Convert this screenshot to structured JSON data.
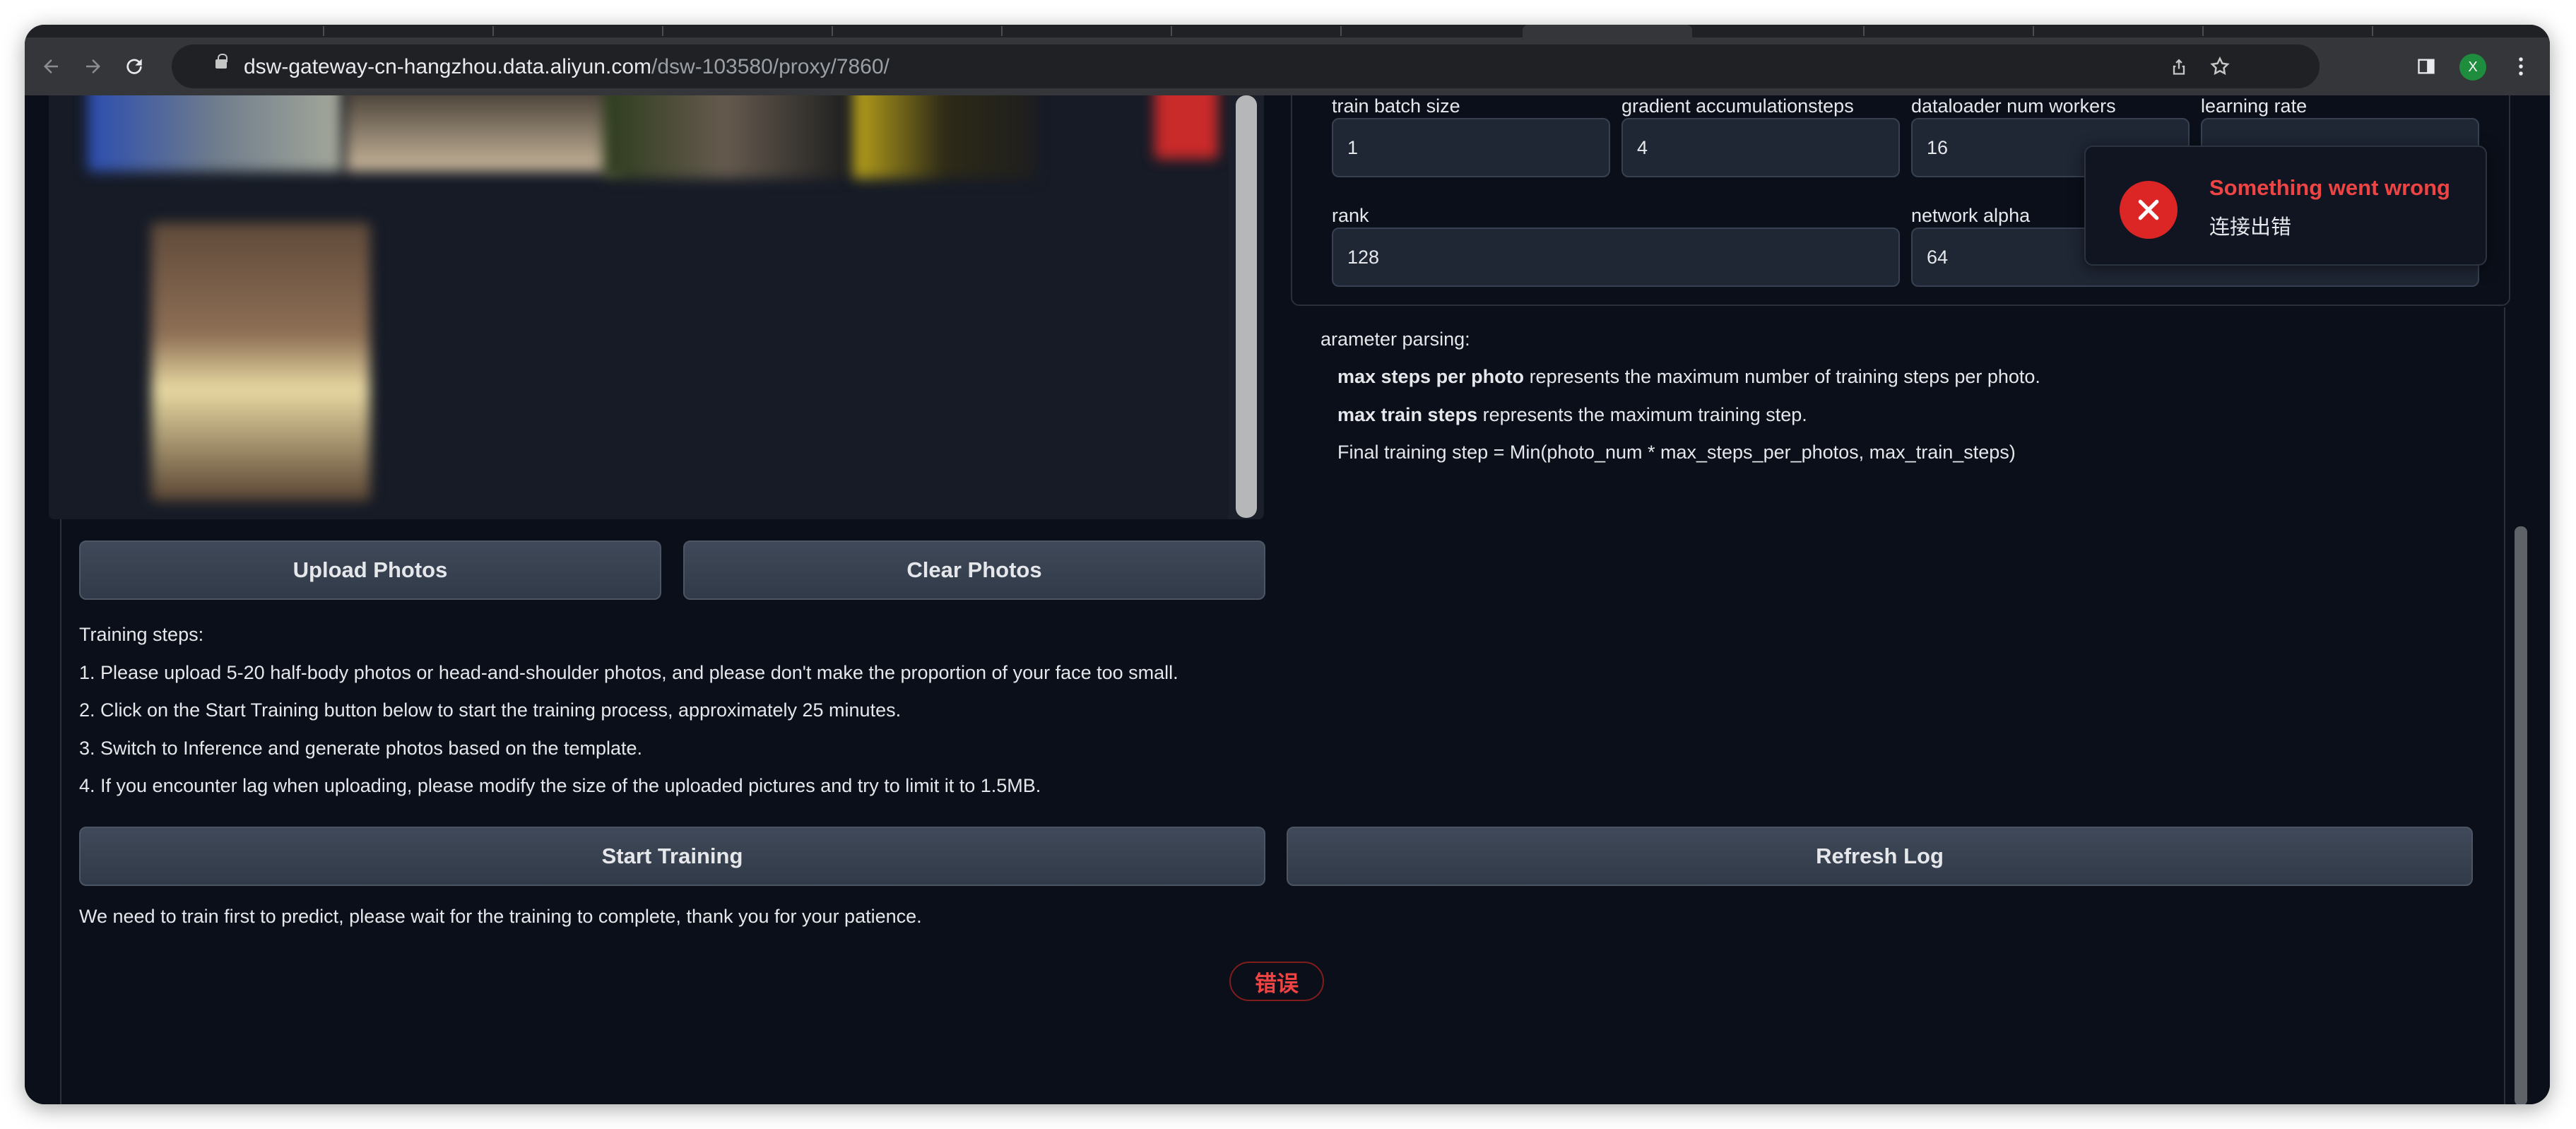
{
  "browser": {
    "url_host": "dsw-gateway-cn-hangzhou.data.aliyun.com",
    "url_path": "/dsw-103580/proxy/7860/",
    "profile_initial": "X"
  },
  "params": {
    "train_batch_size_label": "train batch size",
    "train_batch_size_value": "1",
    "grad_accum_label": "gradient accumulationsteps",
    "grad_accum_value": "4",
    "dataloader_label": "dataloader num workers",
    "dataloader_value": "16",
    "learning_rate_label": "learning rate",
    "rank_label": "rank",
    "rank_value": "128",
    "network_alpha_label": "network alpha",
    "network_alpha_value": "64"
  },
  "parsing": {
    "heading": "arameter parsing:",
    "line1_bold": "max steps per photo",
    "line1_rest": " represents the maximum number of training steps per photo.",
    "line2_bold": "max train steps",
    "line2_rest": " represents the maximum training step.",
    "line3": "Final training step = Min(photo_num * max_steps_per_photos, max_train_steps)"
  },
  "buttons": {
    "upload": "Upload Photos",
    "clear": "Clear Photos",
    "start": "Start Training",
    "refresh": "Refresh Log"
  },
  "steps": {
    "heading": "Training steps:",
    "s1": "1. Please upload 5-20 half-body photos or head-and-shoulder photos, and please don't make the proportion of your face too small.",
    "s2": "2. Click on the Start Training button below to start the training process, approximately 25 minutes.",
    "s3": "3. Switch to Inference and generate photos based on the template.",
    "s4": "4. If you encounter lag when uploading, please modify the size of the uploaded pictures and try to limit it to 1.5MB."
  },
  "notice": "We need to train first to predict, please wait for the training to complete, thank you for your patience.",
  "error_badge": "错误",
  "toast": {
    "title": "Something went wrong",
    "message": "连接出错"
  },
  "colors": {
    "background": "#0b0f19",
    "error": "#ef4444",
    "button": "#374151"
  },
  "icons": [
    "back-icon",
    "forward-icon",
    "reload-icon",
    "lock-icon",
    "share-icon",
    "star-icon",
    "sidebar-icon",
    "menu-icon",
    "error-icon"
  ]
}
